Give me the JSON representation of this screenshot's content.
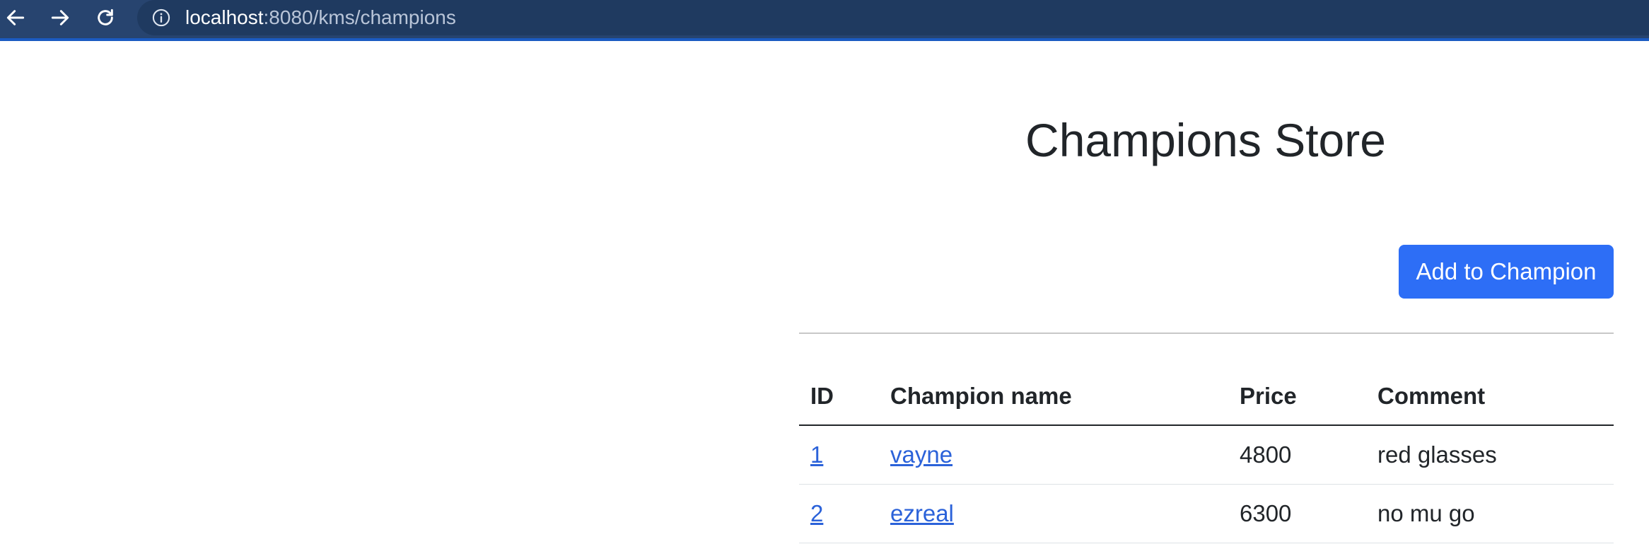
{
  "browser": {
    "url_host": "localhost",
    "url_path": ":8080/kms/champions"
  },
  "page": {
    "title": "Champions Store",
    "add_button_label": "Add to Champion"
  },
  "table": {
    "headers": {
      "id": "ID",
      "name": "Champion name",
      "price": "Price",
      "comment": "Comment"
    },
    "rows": [
      {
        "id": "1",
        "name": "vayne",
        "price": "4800",
        "comment": "red glasses"
      },
      {
        "id": "2",
        "name": "ezreal",
        "price": "6300",
        "comment": "no mu go"
      }
    ]
  },
  "colors": {
    "browser_bar": "#27446f",
    "address_bar": "#1f3a60",
    "accent_button": "#2d6ef6",
    "link": "#2b62d9"
  }
}
